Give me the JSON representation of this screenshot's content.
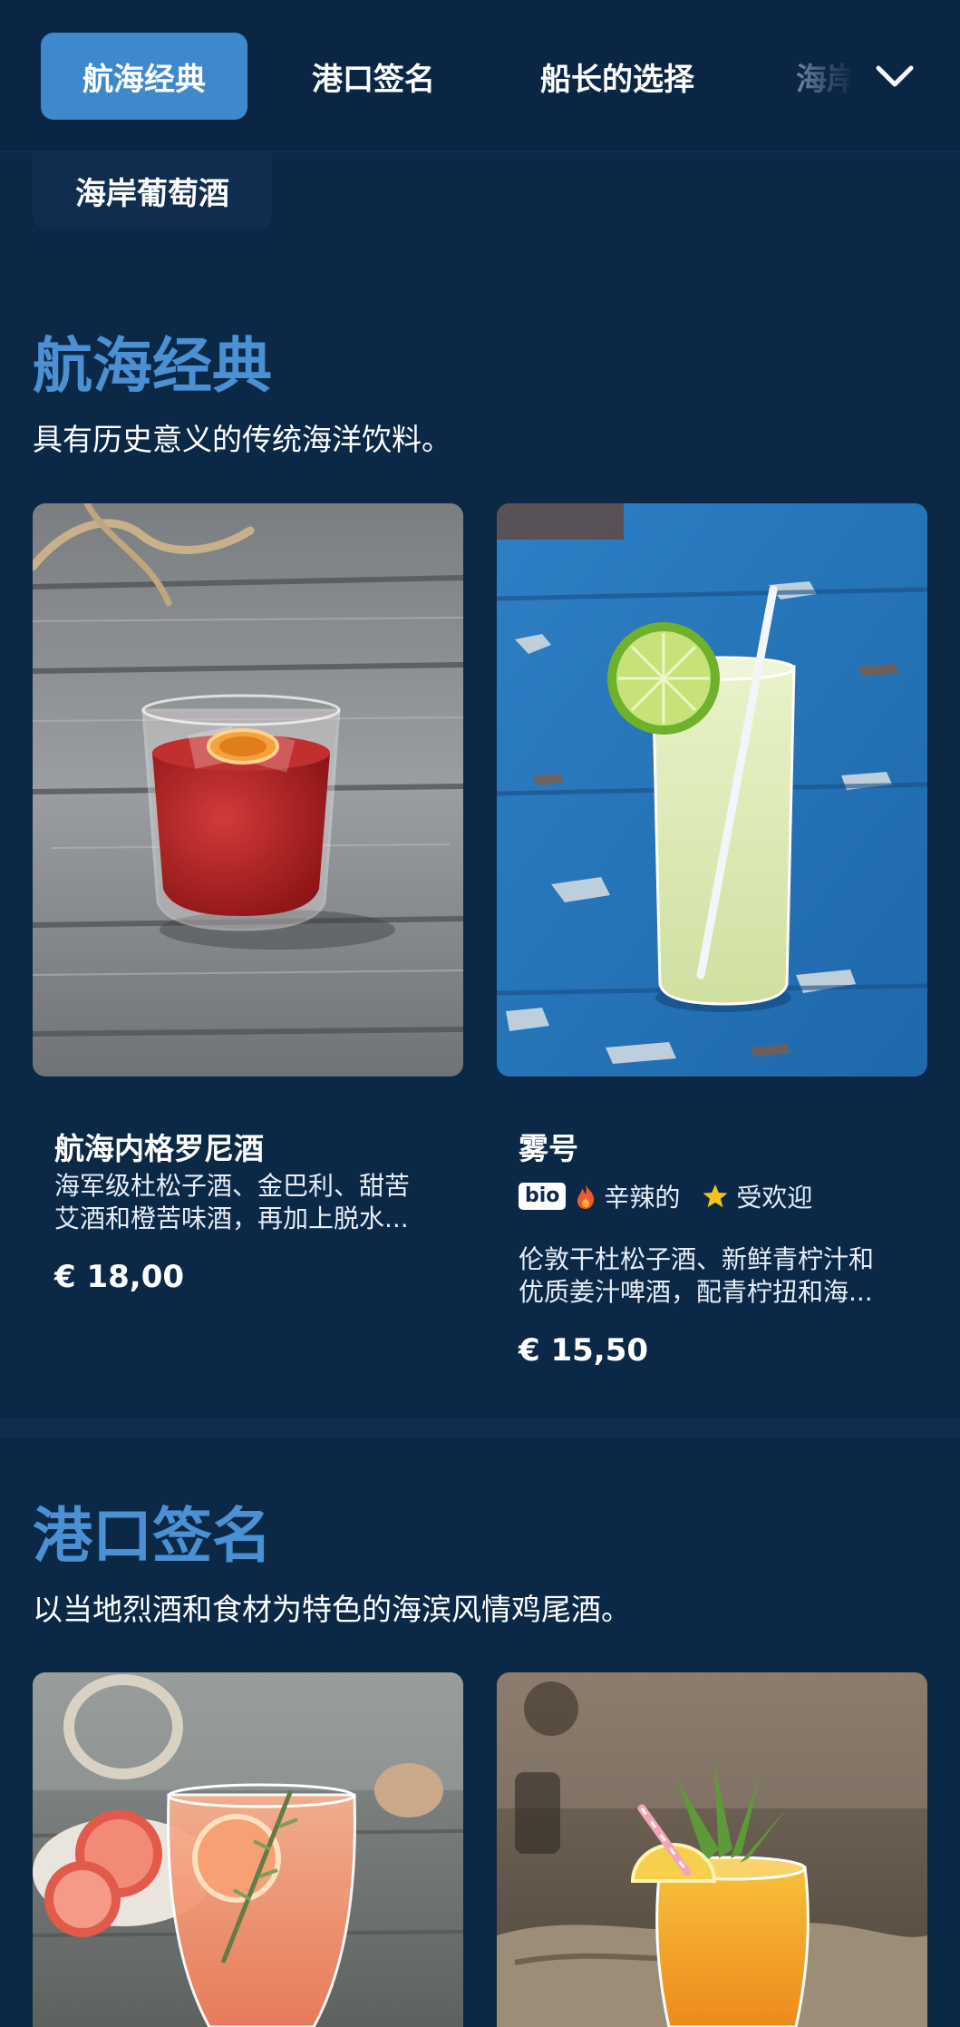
{
  "nav": {
    "tabs": [
      {
        "label": "航海经典",
        "active": true
      },
      {
        "label": "港口签名",
        "active": false
      },
      {
        "label": "船长的选择",
        "active": false
      },
      {
        "label": "海岸",
        "active": false
      }
    ],
    "overflow_tab": "海岸葡萄酒",
    "expand_icon": "chevron-down-icon"
  },
  "sections": [
    {
      "title": "航海经典",
      "subtitle": "具有历史意义的传统海洋饮料。",
      "items": [
        {
          "name": "航海内格罗尼酒",
          "desc_lines": [
            "海军级杜松子酒、金巴利、甜苦",
            "艾酒和橙苦味酒，再加上脱水..."
          ],
          "price": "€ 18,00"
        },
        {
          "name": "雾号",
          "tags": {
            "badge": "bio",
            "spicy": "辛辣的",
            "popular": "受欢迎"
          },
          "desc_lines": [
            "伦敦干杜松子酒、新鲜青柠汁和",
            "优质姜汁啤酒，配青柠扭和海..."
          ],
          "price": "€ 15,50"
        }
      ]
    },
    {
      "title": "港口签名",
      "subtitle": "以当地烈酒和食材为特色的海滨风情鸡尾酒。"
    }
  ],
  "colors": {
    "background": "#0c2847",
    "accent": "#3f88cc",
    "section_title": "#4a90d2",
    "spicy_icon": "#f0592a",
    "star_icon": "#f6c21c"
  }
}
